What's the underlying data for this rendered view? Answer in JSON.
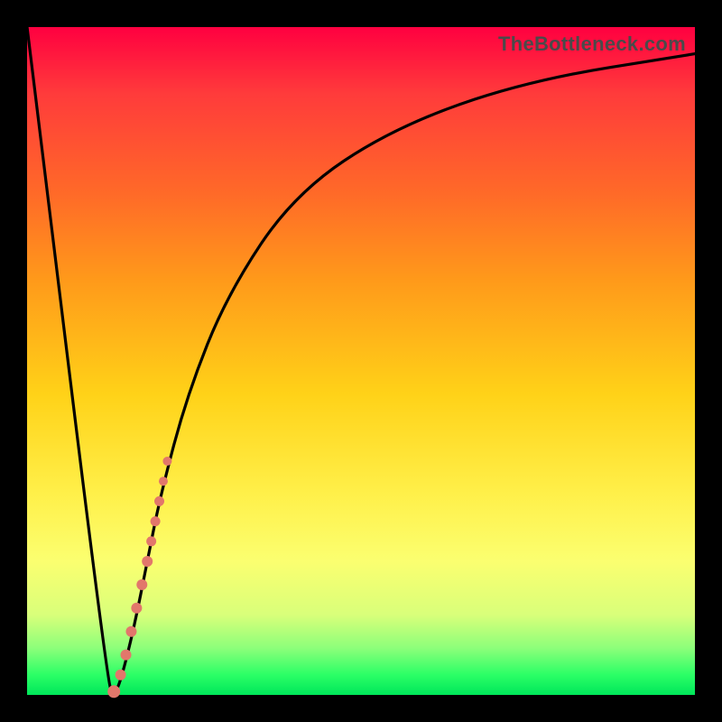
{
  "watermark": "TheBottleneck.com",
  "colors": {
    "dot": "#e2776b",
    "curve": "#000000",
    "frame": "#000000"
  },
  "chart_data": {
    "type": "line",
    "title": "",
    "xlabel": "",
    "ylabel": "",
    "xlim": [
      0,
      100
    ],
    "ylim": [
      0,
      100
    ],
    "grid": false,
    "series": [
      {
        "name": "bottleneck-curve",
        "x": [
          0,
          12,
          13,
          14,
          16,
          18,
          20,
          24,
          30,
          40,
          55,
          75,
          100
        ],
        "y": [
          100,
          2,
          0,
          2,
          10,
          20,
          30,
          45,
          60,
          75,
          85,
          92,
          96
        ]
      },
      {
        "name": "highlight-dots",
        "x": [
          13.0,
          14.0,
          14.8,
          15.6,
          16.4,
          17.2,
          18.0,
          18.6,
          19.2,
          19.8,
          20.4,
          21.0
        ],
        "y": [
          0.5,
          3.0,
          6.0,
          9.5,
          13.0,
          16.5,
          20.0,
          23.0,
          26.0,
          29.0,
          32.0,
          35.0
        ],
        "r": [
          7,
          6,
          6,
          6,
          6,
          6,
          6,
          5.5,
          5.5,
          5.5,
          5,
          5
        ]
      }
    ]
  }
}
